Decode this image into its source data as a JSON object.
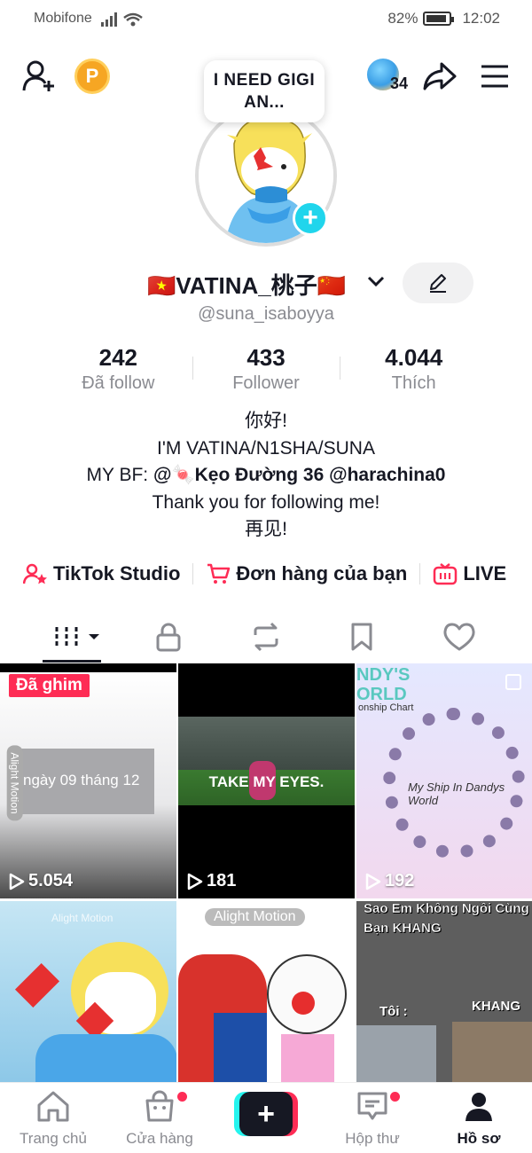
{
  "status": {
    "carrier": "Mobifone",
    "battery": "82%",
    "time": "12:02"
  },
  "topbar": {
    "coin_label": "P",
    "note": "I NEED GIGI AN...",
    "friends_count": "34"
  },
  "profile": {
    "display_name": "🇻🇳VATINA_桃子🇨🇳",
    "handle": "@suna_isaboyya",
    "stats": [
      {
        "value": "242",
        "label": "Đã follow"
      },
      {
        "value": "433",
        "label": "Follower"
      },
      {
        "value": "4.044",
        "label": "Thích"
      }
    ],
    "bio": {
      "line1": "你好!",
      "line2": "I'M VATINA/N1SHA/SUNA",
      "line3_prefix": "MY BF: ",
      "line3_mention1": "@🍬Kẹo Đường 36",
      "line3_mention2": "@harachina0",
      "line4": "Thank you for following me!",
      "line5": "再见!"
    }
  },
  "links": {
    "studio": "TikTok Studio",
    "orders": "Đơn hàng của bạn",
    "live": "LIVE"
  },
  "videos": [
    {
      "views": "5.054",
      "pinned": "Đã ghim",
      "caption": "ngày 09 tháng 12",
      "watermark": "Alight Motion"
    },
    {
      "views": "181",
      "caption": "TAKE MY EYES."
    },
    {
      "views": "192",
      "title": "NDY'S ORLD",
      "subtitle": "onship Chart",
      "caption": "My Ship In Dandys World"
    },
    {
      "watermark": "Alight Motion"
    },
    {
      "watermark": "Alight Motion"
    },
    {
      "title": "Sao Em Không Ngồi Cùng Bạn KHANG",
      "label_left": "Tôi :",
      "label_right": "KHANG"
    }
  ],
  "nav": {
    "home": "Trang chủ",
    "shop": "Cửa hàng",
    "inbox": "Hộp thư",
    "profile": "Hồ sơ"
  },
  "colors": {
    "accent": "#fe2c55",
    "cyan": "#25f4ee"
  }
}
